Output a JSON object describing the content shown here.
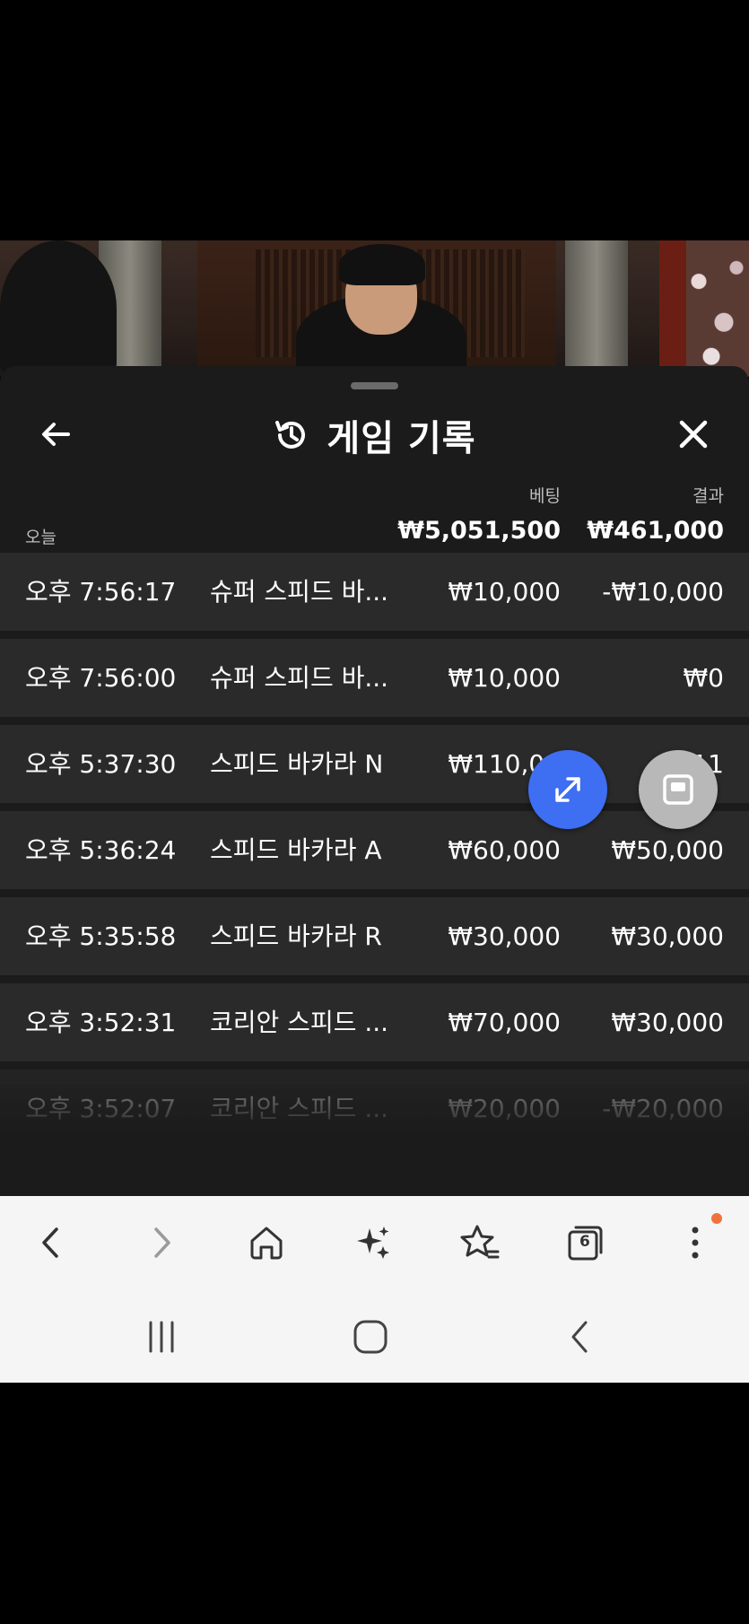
{
  "header": {
    "title": "게임 기록",
    "back_icon": "arrow-left-icon",
    "history_icon": "history-icon",
    "close_icon": "close-icon"
  },
  "summary": {
    "period_label": "오늘",
    "bet_label": "베팅",
    "result_label": "결과",
    "bet_total": "₩5,051,500",
    "result_total": "₩461,000"
  },
  "records": [
    {
      "time": "오후 7:56:17",
      "game": "슈퍼 스피드 바...",
      "bet": "₩10,000",
      "result": "-₩10,000"
    },
    {
      "time": "오후 7:56:00",
      "game": "슈퍼 스피드 바...",
      "bet": "₩10,000",
      "result": "₩0"
    },
    {
      "time": "오후 5:37:30",
      "game": "스피드 바카라 N",
      "bet": "₩110,00",
      "result": "₩11"
    },
    {
      "time": "오후 5:36:24",
      "game": "스피드 바카라 A",
      "bet": "₩60,000",
      "result": "₩50,000"
    },
    {
      "time": "오후 5:35:58",
      "game": "스피드 바카라 R",
      "bet": "₩30,000",
      "result": "₩30,000"
    },
    {
      "time": "오후 3:52:31",
      "game": "코리안 스피드 ...",
      "bet": "₩70,000",
      "result": "₩30,000"
    },
    {
      "time": "오후 3:52:07",
      "game": "코리안 스피드 ...",
      "bet": "₩20,000",
      "result": "-₩20,000"
    }
  ],
  "fabs": {
    "expand_icon": "expand-icon",
    "pip_icon": "picture-in-picture-icon"
  },
  "browser_toolbar": {
    "tab_count": "6",
    "icons": [
      "back-icon",
      "forward-icon",
      "home-icon",
      "sparkle-icon",
      "bookmark-star-icon",
      "tabs-icon",
      "more-vertical-icon"
    ]
  },
  "colors": {
    "sheet_bg": "#1b1b1b",
    "row_bg": "#2a2a2a",
    "accent_blue": "#3e6ef2",
    "notification_dot": "#f0723a"
  }
}
